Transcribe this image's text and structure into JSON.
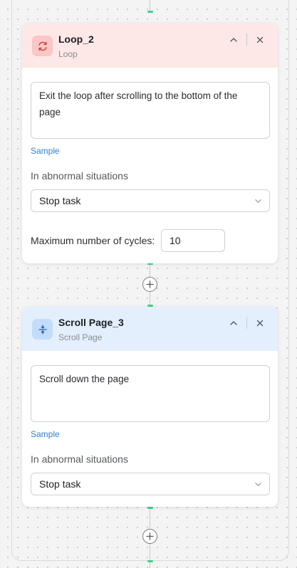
{
  "colors": {
    "loop_header_bg": "#fde7e7",
    "loop_badge_bg": "#fbc6c6",
    "scroll_header_bg": "#e3effd",
    "scroll_badge_bg": "#c4dcfb",
    "connector_accent": "#3fd08a",
    "link": "#2f7fd8"
  },
  "nodes": [
    {
      "title": "Loop_2",
      "subtitle": "Loop",
      "icon": "loop-icon",
      "description": "Exit the loop after scrolling to the bottom of the page",
      "sample_label": "Sample",
      "abnormal_label": "In abnormal situations",
      "abnormal_value": "Stop task",
      "max_cycles_label": "Maximum number of cycles:",
      "max_cycles_value": "10"
    },
    {
      "title": "Scroll Page_3",
      "subtitle": "Scroll Page",
      "icon": "scroll-page-icon",
      "description": "Scroll down the page",
      "sample_label": "Sample",
      "abnormal_label": "In abnormal situations",
      "abnormal_value": "Stop task"
    }
  ],
  "icons": {
    "collapse": "chevron-up-icon",
    "close": "close-icon",
    "add": "plus-icon",
    "dropdown": "chevron-down-icon"
  }
}
